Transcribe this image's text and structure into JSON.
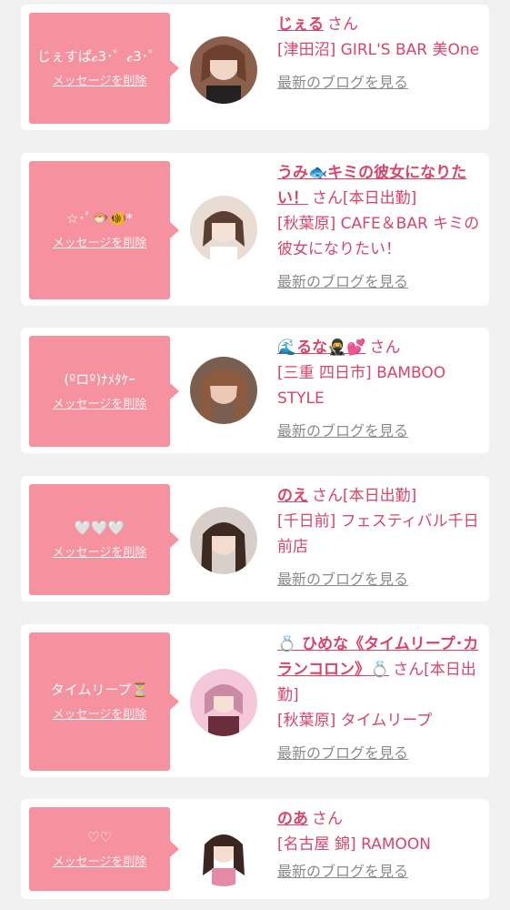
{
  "cards": [
    {
      "message": "じぇすぱ𝓬3･゜𝓬3･゜",
      "delete_label": "メッセージを削除",
      "name": "じぇる",
      "san": "さん",
      "status": "",
      "shop": "[津田沼] GIRL'S BAR 美One",
      "blog_label": "最新のブログを見る"
    },
    {
      "message": "☆･ﾟ🐡🐠*",
      "delete_label": "メッセージを削除",
      "name": "うみ🐟キミの彼女になりたい！",
      "san": "さん",
      "status": "[本日出勤]",
      "shop": "[秋葉原] CAFE＆BAR キミの彼女になりたい！",
      "blog_label": "最新のブログを見る"
    },
    {
      "message": "(ºロº)ﾅﾒﾀｹｰ",
      "delete_label": "メッセージを削除",
      "name": "🌊るな🥷💕",
      "san": "さん",
      "status": "",
      "shop": "[三重 四日市] BAMBOO STYLE",
      "blog_label": "最新のブログを見る"
    },
    {
      "message": "🤍🤍🤍",
      "delete_label": "メッセージを削除",
      "name": "のえ",
      "san": "さん",
      "status": "[本日出勤]",
      "shop": "[千日前] フェスティバル千日前店",
      "blog_label": "最新のブログを見る"
    },
    {
      "message": "タイムリープ⏳",
      "delete_label": "メッセージを削除",
      "name": "💍 ひめな《タイムリープ･カランコロン》💍",
      "san": "さん",
      "status": "[本日出勤]",
      "shop": "[秋葉原] タイムリープ",
      "blog_label": "最新のブログを見る"
    },
    {
      "message": "♡♡",
      "delete_label": "メッセージを削除",
      "name": "のあ",
      "san": "さん",
      "status": "",
      "shop": "[名古屋 錦] RAMOON",
      "blog_label": "最新のブログを見る"
    }
  ],
  "colors": {
    "accent": "#d8456a",
    "bubble": "#f6929f",
    "link_gray": "#8b8b8b",
    "bg": "#f1f1f1"
  }
}
